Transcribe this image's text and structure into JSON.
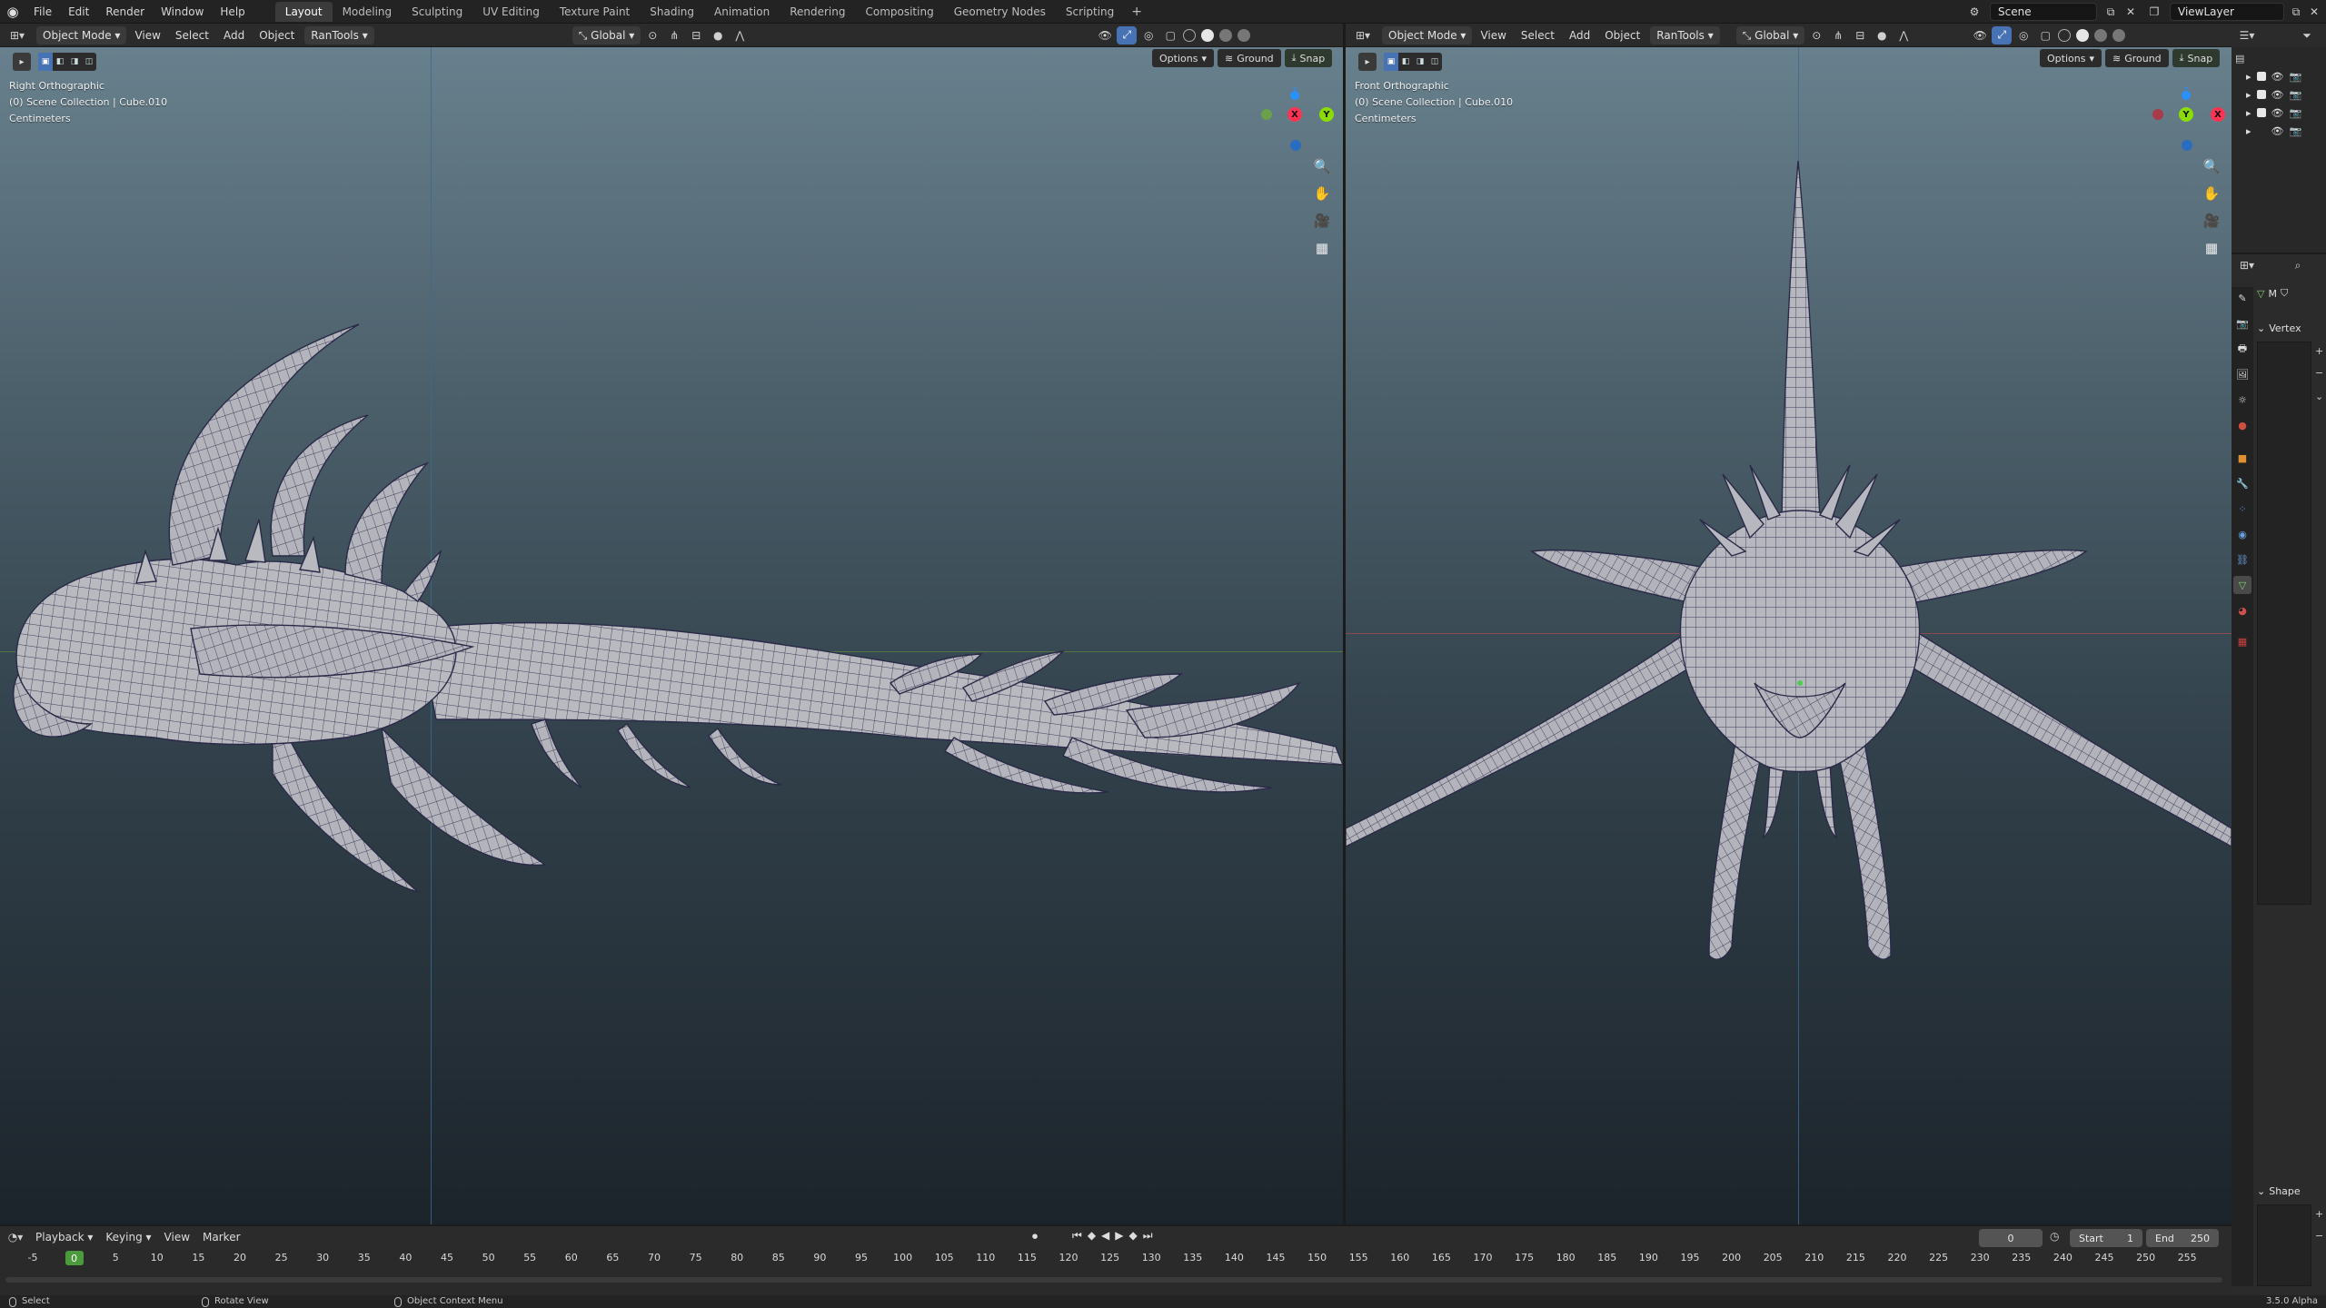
{
  "topbar": {
    "menus": [
      "File",
      "Edit",
      "Render",
      "Window",
      "Help"
    ],
    "workspaces": [
      "Layout",
      "Modeling",
      "Sculpting",
      "UV Editing",
      "Texture Paint",
      "Shading",
      "Animation",
      "Rendering",
      "Compositing",
      "Geometry Nodes",
      "Scripting"
    ],
    "active_workspace": "Layout",
    "add_tab": "+",
    "scene": "Scene",
    "view_layer": "ViewLayer"
  },
  "viewport_header": {
    "mode": "Object Mode",
    "menus": [
      "View",
      "Select",
      "Add",
      "Object",
      "RanTools"
    ],
    "orientation": "Global"
  },
  "overlay_bar": {
    "options": "Options",
    "ground": "Ground",
    "snap": "Snap"
  },
  "left_view": {
    "name": "Right Orthographic",
    "collection": "(0) Scene Collection | Cube.010",
    "units": "Centimeters",
    "gizmo": {
      "z": "Z",
      "x": "X",
      "y": "Y"
    }
  },
  "right_view": {
    "name": "Front Orthographic",
    "collection": "(0) Scene Collection | Cube.010",
    "units": "Centimeters",
    "gizmo": {
      "z": "Z",
      "y": "Y",
      "x": "X"
    }
  },
  "properties": {
    "vertex_panel": "Vertex",
    "shape_panel": "Shape",
    "mesh_label": "M"
  },
  "timeline": {
    "menus": [
      "Playback",
      "Keying",
      "View",
      "Marker"
    ],
    "current_frame": "0",
    "start_label": "Start",
    "start": "1",
    "end_label": "End",
    "end": "250",
    "ticks": [
      "-5",
      "0",
      "5",
      "10",
      "15",
      "20",
      "25",
      "30",
      "35",
      "40",
      "45",
      "50",
      "55",
      "60",
      "65",
      "70",
      "75",
      "80",
      "85",
      "90",
      "95",
      "100",
      "105",
      "110",
      "115",
      "120",
      "125",
      "130",
      "135",
      "140",
      "145",
      "150",
      "155",
      "160",
      "165",
      "170",
      "175",
      "180",
      "185",
      "190",
      "195",
      "200",
      "205",
      "210",
      "215",
      "220",
      "225",
      "230",
      "235",
      "240",
      "245",
      "250",
      "255"
    ]
  },
  "statusbar": {
    "select": "Select",
    "rotate": "Rotate View",
    "context": "Object Context Menu",
    "version": "3.5.0 Alpha"
  },
  "colors": {
    "accent": "#4772b3",
    "axis_x": "#ff3352",
    "axis_y": "#8bdc00",
    "axis_z": "#2890ff",
    "current_frame": "#4b9a3b"
  }
}
